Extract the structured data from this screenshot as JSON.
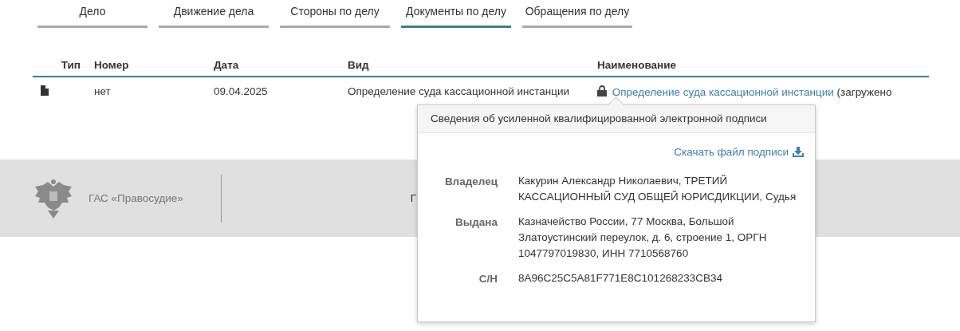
{
  "tabs": [
    {
      "label": "Дело",
      "selected": false
    },
    {
      "label": "Движение дела",
      "selected": false
    },
    {
      "label": "Стороны по делу",
      "selected": false
    },
    {
      "label": "Документы по делу",
      "selected": true
    },
    {
      "label": "Обращения по делу",
      "selected": false
    }
  ],
  "table": {
    "columns": [
      "Тип",
      "Номер",
      "Дата",
      "Вид",
      "Наименование"
    ],
    "rows": [
      {
        "kind": "document",
        "number": "нет",
        "date": "09.04.2025",
        "doc_type": "Определение суда кассационной инстанции",
        "signed": true,
        "name_link": "Определение суда кассационной инстанции",
        "name_note": "(загружено"
      }
    ]
  },
  "footer": {
    "org": "ГАС «Правосудие»",
    "cut_text": "Г"
  },
  "signature_popover": {
    "title": "Сведения об усиленной квалифицированной электронной подписи",
    "download": "Скачать файл подписи",
    "fields": [
      {
        "label": "Владелец",
        "value": "Какурин Александр Николаевич, ТРЕТИЙ КАССАЦИОННЫЙ СУД ОБЩЕЙ ЮРИСДИКЦИИ, Судья"
      },
      {
        "label": "Выдана",
        "value": "Казначейство России, 77 Москва, Большой Златоустинский переулок, д. 6, строение 1, ОРГН 1047797019830, ИНН 7710568760"
      },
      {
        "label": "С/Н",
        "value": "8A96C25C5A81F771E8C101268233CB34"
      }
    ]
  }
}
